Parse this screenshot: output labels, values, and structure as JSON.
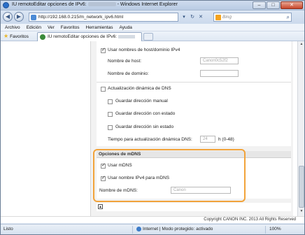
{
  "window": {
    "title_prefix": "IU remotoEditar opciones de IPv6:",
    "title_suffix": "- Windows Internet Explorer",
    "minimize": "–",
    "maximize": "□",
    "close": "✕"
  },
  "navbar": {
    "url": "http://192.168.0.215/m_network_ipv6.html",
    "search_placeholder": "Bing",
    "back_glyph": "◀",
    "forward_glyph": "▶",
    "dropdown_glyph": "▾",
    "refresh_glyph": "↻",
    "stop_glyph": "✕",
    "search_glyph": "⌕"
  },
  "menubar": {
    "items": [
      "Archivo",
      "Edición",
      "Ver",
      "Favoritos",
      "Herramientas",
      "Ayuda"
    ]
  },
  "favbar": {
    "favorites_label": "Favoritos",
    "tab_title": "IU remotoEditar opciones de IPv6:"
  },
  "form": {
    "use_hostname_ipv4": "Usar nombres de host/dominio IPv4",
    "hostname_label": "Nombre de host:",
    "hostname_value": "Canon0c52f2",
    "domain_label": "Nombre de dominio:",
    "domain_value": "",
    "dns_update": "Actualización dinámica de DNS",
    "save_manual": "Guardar dirección manual",
    "save_stateful": "Guardar dirección con estado",
    "save_stateless": "Guardar dirección sin estado",
    "ttl_label": "Tiempo para actualización dinámica DNS:",
    "ttl_value": "24",
    "ttl_unit": "h (0-48)"
  },
  "mdns": {
    "section_title": "Opciones de mDNS",
    "use_mdns": "Usar mDNS",
    "use_ipv4_name": "Usar nombre IPv4 para mDNS",
    "mdns_name_label": "Nombre de mDNS:",
    "mdns_name_value": "Canon"
  },
  "footer": {
    "copyright": "Copyright CANON INC. 2013 All Rights Reserved"
  },
  "statusbar": {
    "left": "Listo",
    "zone": "Internet | Modo protegido: activado",
    "zoom": "100%"
  },
  "colors": {
    "highlight": "#f2a33a",
    "chrome": "#dfe8f3"
  }
}
